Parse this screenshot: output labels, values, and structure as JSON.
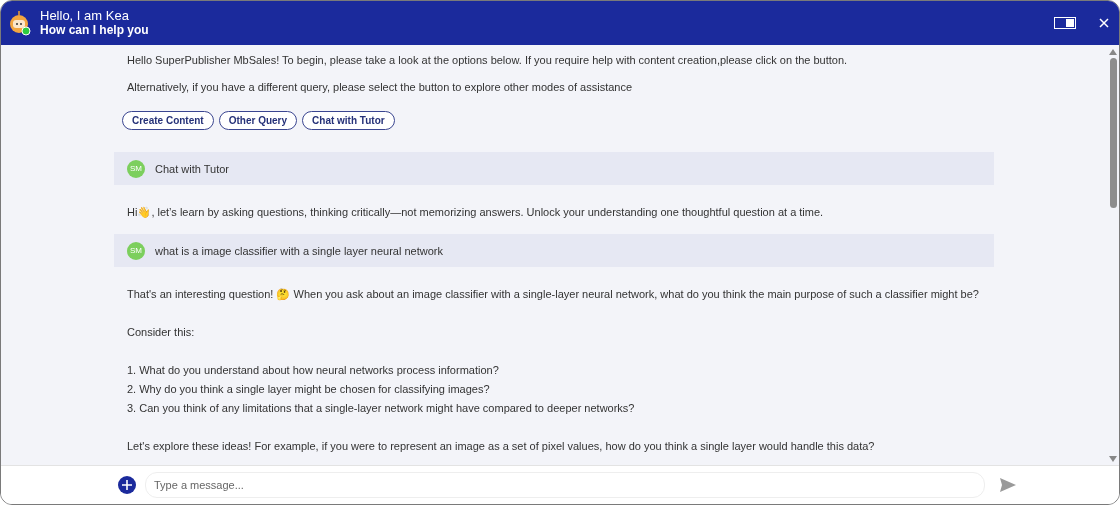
{
  "header": {
    "title": "Hello, I am Kea",
    "subtitle": "How can I help you",
    "online": true
  },
  "intro": [
    "Hello SuperPublisher MbSales! To begin, please take a look at the options below. If you require help with content creation,please click on the button.",
    "Alternatively, if you have a different query, please select the  button to explore other modes of assistance"
  ],
  "options": [
    "Create Content",
    "Other Query",
    "Chat with Tutor"
  ],
  "messages": [
    {
      "kind": "user",
      "avatar": "SM",
      "text": "Chat with Tutor"
    },
    {
      "kind": "bot",
      "paragraphs": [
        "Hi👋, let’s learn by asking questions, thinking critically—not memorizing answers. Unlock your understanding one thoughtful question at a time."
      ]
    },
    {
      "kind": "user",
      "avatar": "SM",
      "text": "what is a image classifier with a single layer neural network"
    },
    {
      "kind": "bot",
      "paragraphs": [
        "That's an interesting question! 🤔 When you ask about an image classifier with a single-layer neural network, what do you think the main purpose of such a classifier might be?",
        "Consider this:",
        "1. What do you understand about how neural networks process information?\n2. Why do you think a single layer might be chosen for classifying images?\n3. Can you think of any limitations that a single-layer network might have compared to deeper networks?",
        "Let's explore these ideas! For example, if you were to represent an image as a set of pixel values, how do you think a single layer would handle this data?"
      ]
    }
  ],
  "composer": {
    "placeholder": "Type a message..."
  }
}
